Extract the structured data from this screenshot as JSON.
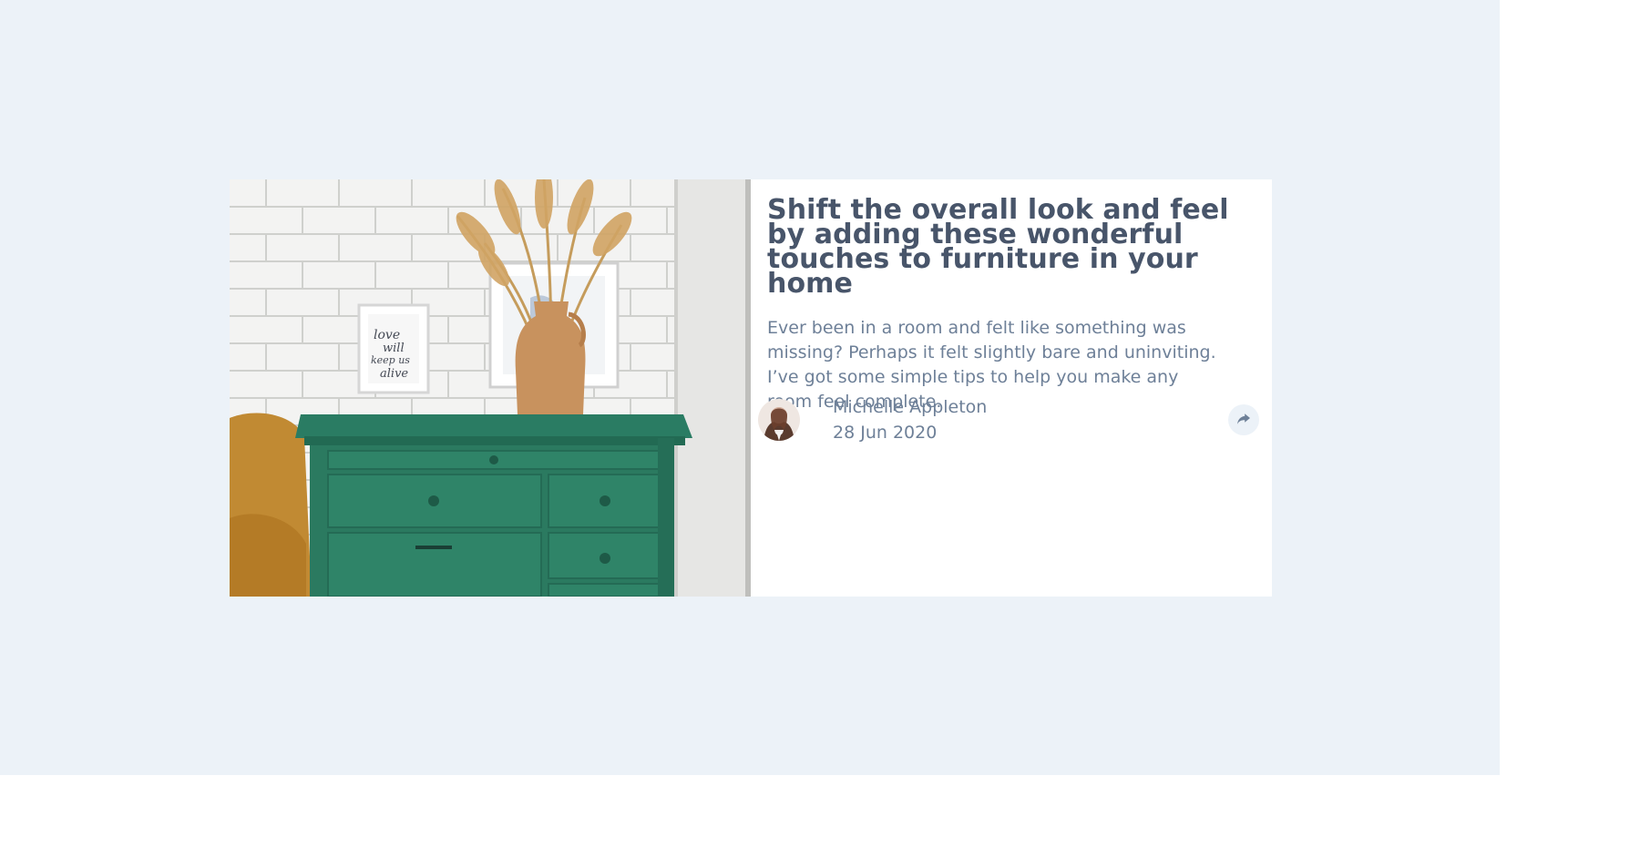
{
  "card": {
    "title": "Shift the overall look and feel by adding these wonderful touches to furniture in your home",
    "description": "Ever been in a room and felt like something was missing? Perhaps it felt slightly bare and uninviting. I’ve got some simple tips to help you make any room feel complete."
  },
  "image": {
    "frame_text": [
      "love",
      "will",
      "keep us",
      "alive"
    ]
  },
  "author": {
    "name": "Michelle Appleton",
    "date": "28 Jun 2020"
  },
  "colors": {
    "backdrop": "#ecf2f8",
    "title": "#48556a",
    "body": "#6e8098",
    "share_bg": "#ecf2f8",
    "share_icon": "#6e8098"
  },
  "icons": {
    "share": "share-icon"
  }
}
